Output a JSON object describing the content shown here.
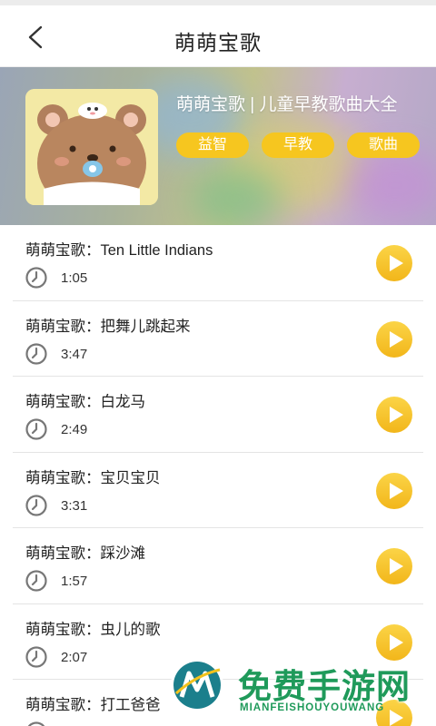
{
  "header": {
    "title": "萌萌宝歌"
  },
  "album": {
    "title": "萌萌宝歌 | 儿童早教歌曲大全",
    "tags": [
      "益智",
      "早教",
      "歌曲"
    ]
  },
  "songs": [
    {
      "name": "萌萌宝歌：Ten Little Indians",
      "duration": "1:05"
    },
    {
      "name": "萌萌宝歌：把舞儿跳起来",
      "duration": "3:47"
    },
    {
      "name": "萌萌宝歌：白龙马",
      "duration": "2:49"
    },
    {
      "name": "萌萌宝歌：宝贝宝贝",
      "duration": "3:31"
    },
    {
      "name": "萌萌宝歌：踩沙滩",
      "duration": "1:57"
    },
    {
      "name": "萌萌宝歌：虫儿的歌",
      "duration": "2:07"
    },
    {
      "name": "萌萌宝歌：打工爸爸",
      "duration": ""
    }
  ],
  "watermark": {
    "title": "免费手游网",
    "subtitle": "MIANFEISHOUYOUWANG"
  },
  "colors": {
    "accent": "#f6c61f",
    "play": "#f5bd22",
    "watermark": "#1f9a5a"
  },
  "icons": {
    "back": "chevron-left-icon",
    "clock": "clock-icon",
    "play": "play-icon"
  }
}
